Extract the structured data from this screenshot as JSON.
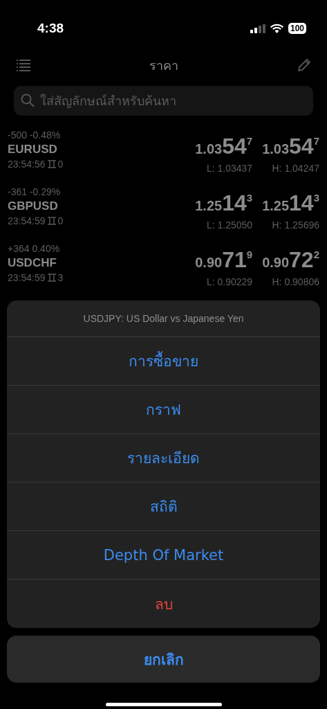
{
  "status_bar": {
    "time": "4:38",
    "battery": "100"
  },
  "nav": {
    "title": "ราคา"
  },
  "search": {
    "placeholder": "ใส่สัญลักษณ์สำหรับค้นหา"
  },
  "quotes": [
    {
      "change": "-500",
      "change_pct": "-0.48%",
      "symbol": "EURUSD",
      "time": "23:54:56",
      "spread": "0",
      "bid": {
        "prefix": "1.03",
        "big": "54",
        "sup": "7"
      },
      "ask": {
        "prefix": "1.03",
        "big": "54",
        "sup": "7"
      },
      "low": "L: 1.03437",
      "high": "H: 1.04247"
    },
    {
      "change": "-361",
      "change_pct": "-0.29%",
      "symbol": "GBPUSD",
      "time": "23:54:59",
      "spread": "0",
      "bid": {
        "prefix": "1.25",
        "big": "14",
        "sup": "3"
      },
      "ask": {
        "prefix": "1.25",
        "big": "14",
        "sup": "3"
      },
      "low": "L: 1.25050",
      "high": "H: 1.25696"
    },
    {
      "change": "+364",
      "change_pct": "0.40%",
      "symbol": "USDCHF",
      "time": "23:54:59",
      "spread": "3",
      "bid": {
        "prefix": "0.90",
        "big": "71",
        "sup": "9"
      },
      "ask": {
        "prefix": "0.90",
        "big": "72",
        "sup": "2"
      },
      "low": "L: 0.90229",
      "high": "H: 0.90806"
    }
  ],
  "action_sheet": {
    "title": "USDJPY: US Dollar vs Japanese Yen",
    "actions": [
      {
        "label": "การซื้อขาย",
        "kind": "default"
      },
      {
        "label": "กราฟ",
        "kind": "default"
      },
      {
        "label": "รายละเอียด",
        "kind": "default"
      },
      {
        "label": "สถิติ",
        "kind": "default"
      },
      {
        "label": "Depth Of Market",
        "kind": "default"
      },
      {
        "label": "ลบ",
        "kind": "destructive"
      }
    ],
    "cancel": "ยกเลิก"
  }
}
